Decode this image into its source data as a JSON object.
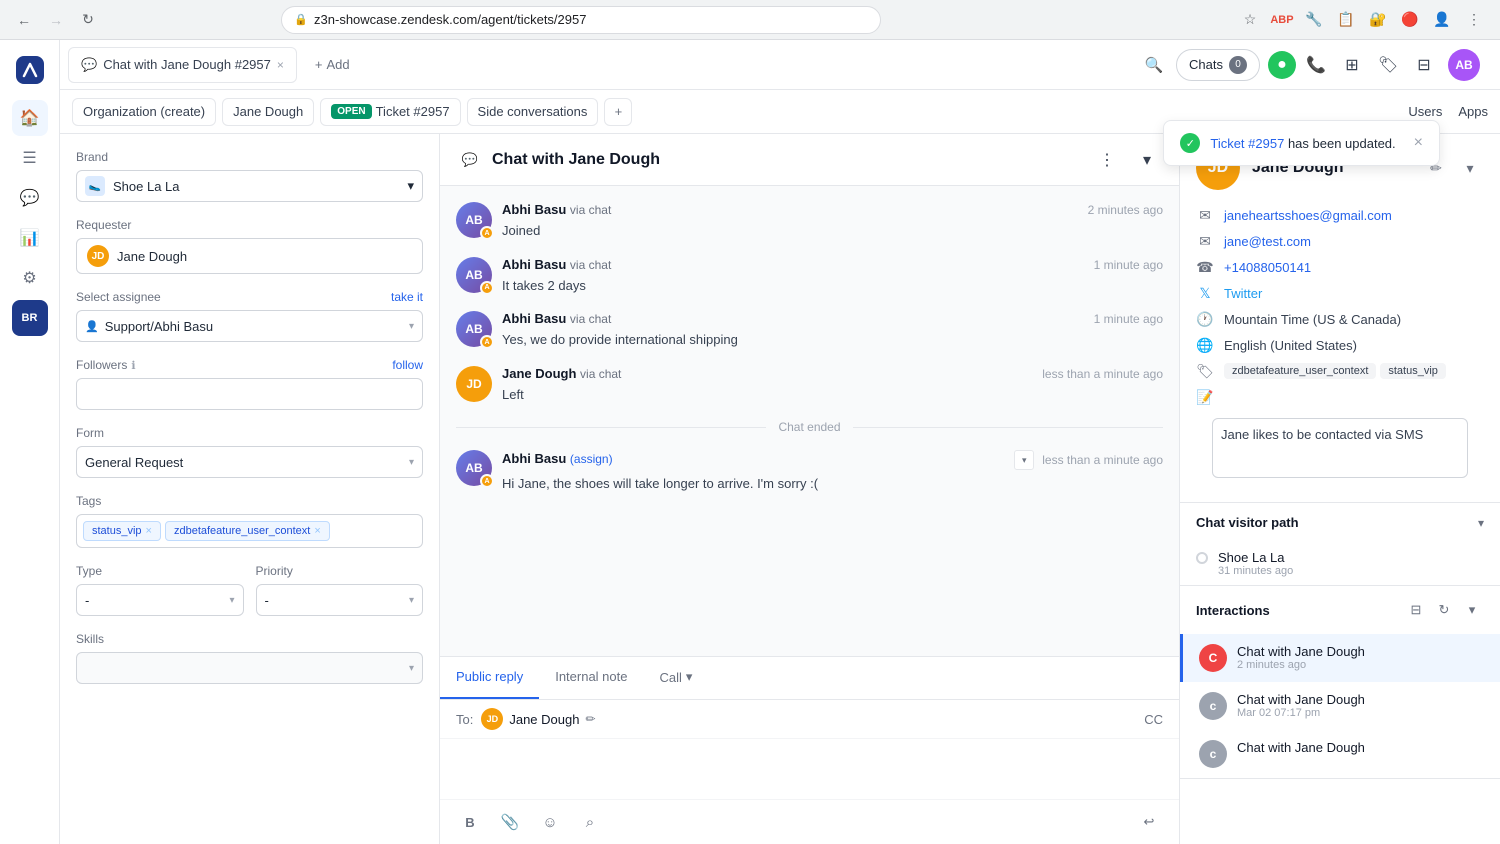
{
  "browser": {
    "url": "z3n-showcase.zendesk.com/agent/tickets/2957",
    "back_disabled": false,
    "forward_disabled": true
  },
  "tabs": [
    {
      "id": "ticket-2957",
      "label": "Chat with Jane Dough #2957",
      "active": true,
      "closeable": true
    },
    {
      "id": "add",
      "label": "+ Add",
      "active": false,
      "closeable": false
    }
  ],
  "top": {
    "search_placeholder": "Search",
    "chats_label": "Chats",
    "chats_count": "0",
    "users_label": "Users",
    "apps_label": "Apps"
  },
  "breadcrumbs": [
    {
      "label": "Organization (create)"
    },
    {
      "label": "Jane Dough"
    },
    {
      "badge": "OPEN",
      "label": "Ticket #2957"
    },
    {
      "label": "Side conversations"
    }
  ],
  "left_panel": {
    "brand_label": "Brand",
    "brand_value": "Shoe La La",
    "requester_label": "Requester",
    "requester_value": "Jane Dough",
    "assignee_label": "Select assignee",
    "assignee_value": "Support/Abhi Basu",
    "take_it_label": "take it",
    "followers_label": "Followers",
    "follow_label": "follow",
    "form_label": "Form",
    "form_value": "General Request",
    "tags_label": "Tags",
    "tags": [
      "status_vip",
      "zdbetafeature_user_context"
    ],
    "type_label": "Type",
    "type_value": "-",
    "priority_label": "Priority",
    "priority_value": "-",
    "skills_label": "Skills"
  },
  "chat": {
    "title": "Chat with Jane Dough",
    "messages": [
      {
        "sender": "Abhi Basu",
        "channel": "via chat",
        "time": "2 minutes ago",
        "text": "Joined",
        "avatar_initials": "AB",
        "is_agent": true
      },
      {
        "sender": "Abhi Basu",
        "channel": "via chat",
        "time": "1 minute ago",
        "text": "It takes 2 days",
        "avatar_initials": "AB",
        "is_agent": true
      },
      {
        "sender": "Abhi Basu",
        "channel": "via chat",
        "time": "1 minute ago",
        "text": "Yes, we do provide international shipping",
        "avatar_initials": "AB",
        "is_agent": true
      },
      {
        "sender": "Jane Dough",
        "channel": "via chat",
        "time": "less than a minute ago",
        "text": "Left",
        "avatar_initials": "JD",
        "is_agent": false
      }
    ],
    "chat_ended_label": "Chat ended",
    "post_message": {
      "sender": "Abhi Basu",
      "assign_label": "(assign)",
      "time": "less than a minute ago",
      "text": "Hi Jane, the shoes will take longer to arrive. I'm sorry :("
    }
  },
  "composer": {
    "public_reply_tab": "Public reply",
    "internal_note_tab": "Internal note",
    "call_tab": "Call",
    "to_label": "To:",
    "recipient": "Jane Dough",
    "cc_label": "CC"
  },
  "right_panel": {
    "contact": {
      "name": "Jane Dough",
      "initials": "JD",
      "email1": "janeheartsshoes@gmail.com",
      "email2": "jane@test.com",
      "phone": "+14088050141",
      "twitter": "Twitter",
      "timezone": "Mountain Time (US & Canada)",
      "language": "English (United States)",
      "tags": [
        "zdbetafeature_user_context",
        "status_vip"
      ],
      "notes": "Jane likes to be contacted via SMS"
    },
    "visitor_path": {
      "title": "Chat visitor path",
      "items": [
        {
          "site": "Shoe La La",
          "time": "31 minutes ago"
        }
      ]
    },
    "interactions": {
      "title": "Interactions",
      "items": [
        {
          "label": "C",
          "title": "Chat with Jane Dough",
          "time": "2 minutes ago",
          "active": true,
          "badge_color": "red"
        },
        {
          "label": "c",
          "title": "Chat with Jane Dough",
          "time": "Mar 02 07:17 pm",
          "active": false,
          "badge_color": "gray"
        },
        {
          "label": "c",
          "title": "Chat with Jane Dough",
          "time": "",
          "active": false,
          "badge_color": "gray"
        }
      ]
    }
  },
  "toast": {
    "ticket_link": "Ticket #2957",
    "message": "has been updated.",
    "check_icon": "✓"
  },
  "icons": {
    "back": "←",
    "forward": "→",
    "refresh": "↻",
    "lock": "🔒",
    "star": "☆",
    "menu": "⋮",
    "home": "⌂",
    "tickets": "≡",
    "chart": "📊",
    "settings": "⚙",
    "search": "🔍",
    "chat_bubble": "💬",
    "phone": "📞",
    "grid": "⊞",
    "tag": "🏷",
    "filter": "⊟",
    "chevron_down": "▾",
    "chevron_up": "▴",
    "pencil": "✏",
    "close": "×",
    "plus": "+",
    "bold": "B",
    "attachment": "📎",
    "emoji": "☺",
    "search_small": "⌕",
    "submit": "➤",
    "more": "⋯",
    "email": "✉",
    "phone_small": "☎",
    "twitter_bird": "🐦",
    "globe": "🌐",
    "clock": "🕐"
  }
}
